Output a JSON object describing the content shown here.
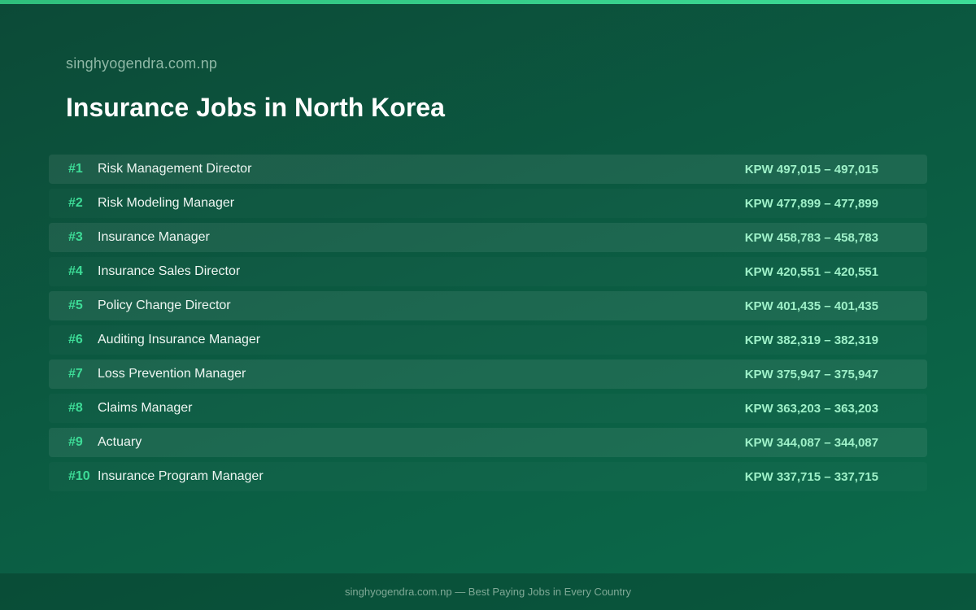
{
  "colors": {
    "accent": "#3ddc97",
    "background": "#0b5a41",
    "salary": "#9ef0c8"
  },
  "header": {
    "site": "singhyogendra.com.np",
    "title": "Insurance Jobs in North Korea"
  },
  "jobs": [
    {
      "rank": "#1",
      "title": "Risk Management Director",
      "salary": "KPW 497,015 – 497,015"
    },
    {
      "rank": "#2",
      "title": "Risk Modeling Manager",
      "salary": "KPW 477,899 – 477,899"
    },
    {
      "rank": "#3",
      "title": "Insurance Manager",
      "salary": "KPW 458,783 – 458,783"
    },
    {
      "rank": "#4",
      "title": "Insurance Sales Director",
      "salary": "KPW 420,551 – 420,551"
    },
    {
      "rank": "#5",
      "title": "Policy Change Director",
      "salary": "KPW 401,435 – 401,435"
    },
    {
      "rank": "#6",
      "title": "Auditing Insurance Manager",
      "salary": "KPW 382,319 – 382,319"
    },
    {
      "rank": "#7",
      "title": "Loss Prevention Manager",
      "salary": "KPW 375,947 – 375,947"
    },
    {
      "rank": "#8",
      "title": "Claims Manager",
      "salary": "KPW 363,203 – 363,203"
    },
    {
      "rank": "#9",
      "title": "Actuary",
      "salary": "KPW 344,087 – 344,087"
    },
    {
      "rank": "#10",
      "title": "Insurance Program Manager",
      "salary": "KPW 337,715 – 337,715"
    }
  ],
  "footer": {
    "text": "singhyogendra.com.np — Best Paying Jobs in Every Country"
  }
}
